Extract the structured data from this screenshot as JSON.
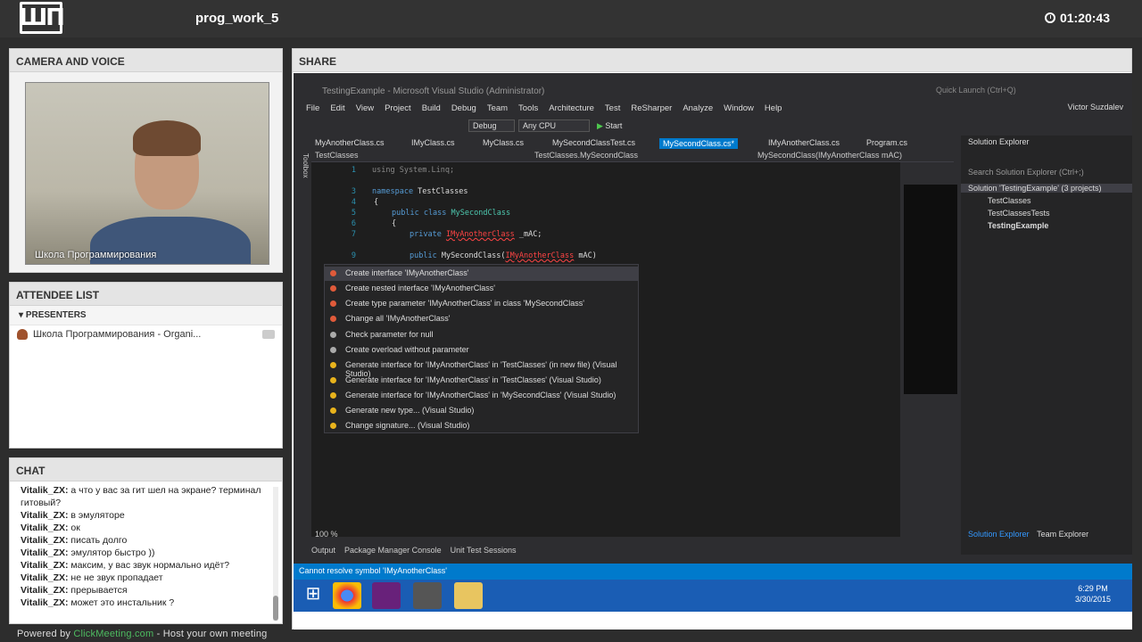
{
  "header": {
    "title": "prog_work_5",
    "timer": "01:20:43",
    "logo": "ШП"
  },
  "camera": {
    "heading": "CAMERA AND VOICE",
    "caption": "Школа Программирования"
  },
  "attendees": {
    "heading": "ATTENDEE LIST",
    "group": "PRESENTERS",
    "items": [
      "Школа Программирования - Organi..."
    ]
  },
  "chat": {
    "heading": "CHAT",
    "lines": [
      {
        "user": "Vitalik_ZX:",
        "text": "а что у вас за гит шел на экране? терминал гитовый?"
      },
      {
        "user": "Vitalik_ZX:",
        "text": "в эмуляторе"
      },
      {
        "user": "Vitalik_ZX:",
        "text": "ок"
      },
      {
        "user": "Vitalik_ZX:",
        "text": "писать долго"
      },
      {
        "user": "Vitalik_ZX:",
        "text": "эмулятор быстро ))"
      },
      {
        "user": "Vitalik_ZX:",
        "text": "максим, у вас звук нормально идёт?"
      },
      {
        "user": "Vitalik_ZX:",
        "text": "не не звук пропадает"
      },
      {
        "user": "Vitalik_ZX:",
        "text": "прерывается"
      },
      {
        "user": "Vitalik_ZX:",
        "text": "может это инстальник ?"
      }
    ]
  },
  "footer": {
    "powered": "Powered by ",
    "link": "ClickMeeting.com",
    "rest": " - Host your own meeting"
  },
  "share": {
    "heading": "SHARE"
  },
  "vs": {
    "title": "TestingExample - Microsoft Visual Studio (Administrator)",
    "quicklaunch": "Quick Launch (Ctrl+Q)",
    "user": "Victor Suzdalev",
    "menu": [
      "File",
      "Edit",
      "View",
      "Project",
      "Build",
      "Debug",
      "Team",
      "Tools",
      "Architecture",
      "Test",
      "ReSharper",
      "Analyze",
      "Window",
      "Help"
    ],
    "config": "Debug",
    "platform": "Any CPU",
    "start": "Start",
    "tabs": [
      "MyAnotherClass.cs",
      "IMyClass.cs",
      "MyClass.cs",
      "MySecondClassTest.cs",
      "MySecondClass.cs*",
      "IMyAnotherClass.cs",
      "Program.cs"
    ],
    "nav": [
      "TestClasses",
      "TestClasses.MySecondClass",
      "MySecondClass(IMyAnotherClass mAC)"
    ],
    "code": {
      "l1": "using System.Linq;",
      "l3a": "namespace",
      "l3b": " TestClasses",
      "l4": "{",
      "l5a": "public class",
      "l5b": " MySecondClass",
      "l6": "{",
      "l7a": "private ",
      "l7b": "IMyAnotherClass",
      "l7c": " _mAC;",
      "l9a": "public ",
      "l9b": "MySecondClass(",
      "l9c": "IMyAnotherClass",
      "l9d": " mAC)"
    },
    "popup": [
      "Create interface 'IMyAnotherClass'",
      "Create nested interface 'IMyAnotherClass'",
      "Create type parameter 'IMyAnotherClass' in class 'MySecondClass'",
      "Change all 'IMyAnotherClass'",
      "Check parameter for null",
      "Create overload without parameter",
      "Generate interface for 'IMyAnotherClass' in 'TestClasses' (in new file) (Visual Studio)",
      "Generate interface for 'IMyAnotherClass' in 'TestClasses' (Visual Studio)",
      "Generate interface for 'IMyAnotherClass' in 'MySecondClass' (Visual Studio)",
      "Generate new type... (Visual Studio)",
      "Change signature... (Visual Studio)"
    ],
    "solution": {
      "heading": "Solution Explorer",
      "search": "Search Solution Explorer (Ctrl+;)",
      "root": "Solution 'TestingExample' (3 projects)",
      "projects": [
        "TestClasses",
        "TestClassesTests",
        "TestingExample"
      ],
      "tab1": "Solution Explorer",
      "tab2": "Team Explorer"
    },
    "zoom": "100 %",
    "bottomtabs": [
      "Output",
      "Package Manager Console",
      "Unit Test Sessions"
    ],
    "status": "Cannot resolve symbol 'IMyAnotherClass'",
    "toolbox": "Toolbox",
    "clock": {
      "time": "6:29 PM",
      "date": "3/30/2015"
    }
  }
}
